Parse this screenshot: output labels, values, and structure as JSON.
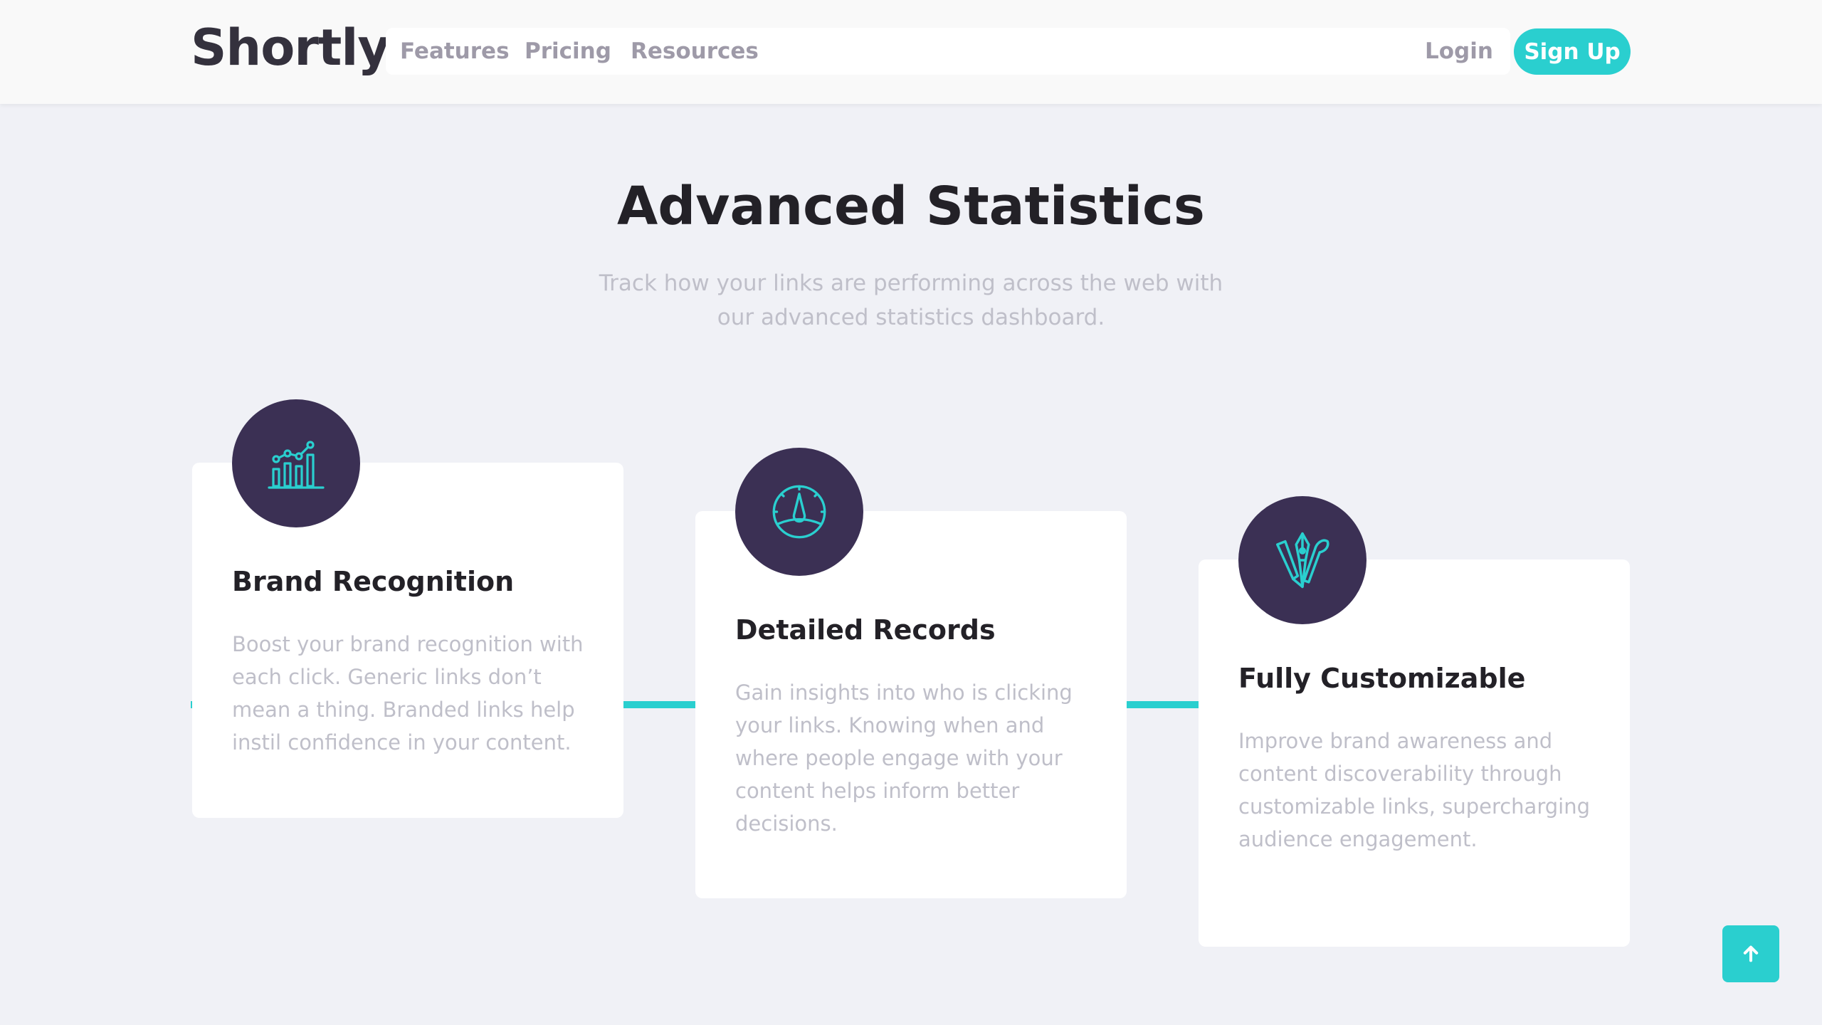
{
  "header": {
    "logo": "Shortly",
    "nav": {
      "features": "Features",
      "pricing": "Pricing",
      "resources": "Resources"
    },
    "login": "Login",
    "signup": "Sign Up"
  },
  "section": {
    "title": "Advanced Statistics",
    "subtitle": "Track how your links are performing across the web with our advanced statistics dashboard."
  },
  "cards": [
    {
      "icon": "brand-recognition-icon",
      "title": "Brand Recognition",
      "text": "Boost your brand recognition with each click. Generic links don’t mean a thing. Branded links help instil confidence in your content."
    },
    {
      "icon": "detailed-records-icon",
      "title": "Detailed Records",
      "text": "Gain insights into who is clicking your links. Knowing when and where people engage with your content helps inform better decisions."
    },
    {
      "icon": "fully-customizable-icon",
      "title": "Fully Customizable",
      "text": "Improve brand awareness and content discoverability through customizable links, supercharging audience engagement."
    }
  ],
  "scroll_top_icon": "arrow-up-icon",
  "colors": {
    "primary": "#2acfcf",
    "dark_violet": "#3b3054",
    "grayish_violet": "#9e9aa8",
    "background": "#f0f1f6"
  }
}
